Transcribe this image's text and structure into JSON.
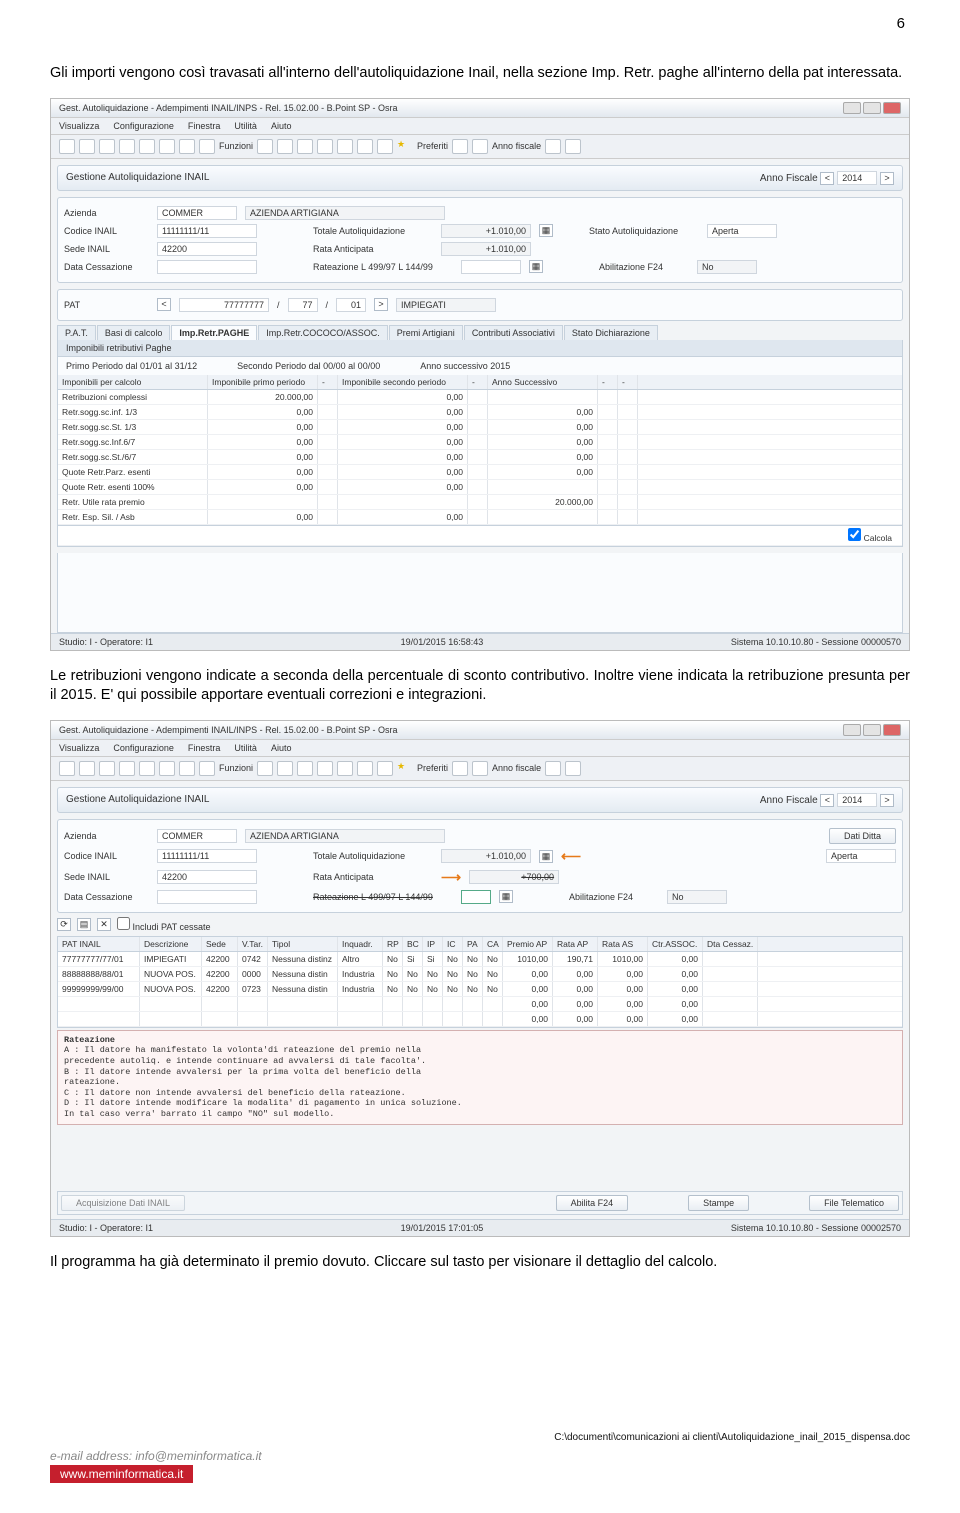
{
  "page_number": "6",
  "para1": "Gli importi vengono così travasati all'interno dell'autoliquidazione Inail, nella sezione Imp. Retr. paghe all'interno della pat interessata.",
  "para2": "Le retribuzioni vengono indicate a seconda della percentuale di sconto contributivo. Inoltre viene indicata la retribuzione presunta per il 2015. E' qui possibile apportare eventuali correzioni e integrazioni.",
  "para3": "Il programma ha già determinato il premio dovuto. Cliccare sul tasto per visionare il dettaglio del calcolo.",
  "footer_path": "C:\\documenti\\comunicazioni ai clienti\\Autoliquidazione_inail_2015_dispensa.doc",
  "footer_email": "e-mail address: info@meminformatica.it",
  "footer_url": "www.meminformatica.it",
  "shot1": {
    "title": "Gest. Autoliquidazione - Adempimenti INAIL/INPS - Rel. 15.02.00 - B.Point SP - Osra",
    "menus": [
      "Visualizza",
      "Configurazione",
      "Finestra",
      "Utilità",
      "Aiuto"
    ],
    "funzioni": "Funzioni",
    "preferiti": "Preferiti",
    "anno_fiscale_lbl": "Anno fiscale",
    "section": "Gestione Autoliquidazione INAIL",
    "anno_fiscale": "2014",
    "anno_lbl": "Anno Fiscale",
    "azienda_lbl": "Azienda",
    "azienda_code": "COMMER",
    "azienda_name": "AZIENDA ARTIGIANA",
    "codice_lbl": "Codice INAIL",
    "codice_val": "11111111/11",
    "totale_lbl": "Totale Autoliquidazione",
    "totale_val": "+1.010,00",
    "stato_lbl": "Stato Autoliquidazione",
    "stato_val": "Aperta",
    "sede_lbl": "Sede INAIL",
    "sede_val": "42200",
    "rata_lbl": "Rata Anticipata",
    "rata_val": "+1.010,00",
    "cess_lbl": "Data Cessazione",
    "rateaz_lbl": "Rateazione L 499/97 L 144/99",
    "abil_lbl": "Abilitazione F24",
    "abil_val": "No",
    "pat_lbl": "PAT",
    "pat_code": "77777777",
    "pat_p1": "77",
    "pat_p2": "01",
    "pat_desc": "IMPIEGATI",
    "tabs": [
      "P.A.T.",
      "Basi di calcolo",
      "Imp.Retr.PAGHE",
      "Imp.Retr.COCOCO/ASSOC.",
      "Premi Artigiani",
      "Contributi Associativi",
      "Stato Dichiarazione"
    ],
    "subheader": "Imponibili retributivi Paghe",
    "period1": "Primo Periodo dal 01/01 al 31/12",
    "period2": "Secondo Periodo dal 00/00 al 00/00",
    "period3": "Anno successivo 2015",
    "grid_headers": [
      "Imponibili per calcolo",
      "Imponibile primo periodo",
      "-",
      "Imponibile secondo periodo",
      "-",
      "Anno Successivo",
      "-",
      "-"
    ],
    "grid_rows": [
      [
        "Retribuzioni complessi",
        "20.000,00",
        "",
        "0,00",
        "",
        "",
        "",
        ""
      ],
      [
        "Retr.sogg.sc.inf. 1/3",
        "0,00",
        "",
        "0,00",
        "",
        "0,00",
        "",
        ""
      ],
      [
        "Retr.sogg.sc.St. 1/3",
        "0,00",
        "",
        "0,00",
        "",
        "0,00",
        "",
        ""
      ],
      [
        "Retr.sogg.sc.Inf.6/7",
        "0,00",
        "",
        "0,00",
        "",
        "0,00",
        "",
        ""
      ],
      [
        "Retr.sogg.sc.St./6/7",
        "0,00",
        "",
        "0,00",
        "",
        "0,00",
        "",
        ""
      ],
      [
        "Quote Retr.Parz. esenti",
        "0,00",
        "",
        "0,00",
        "",
        "0,00",
        "",
        ""
      ],
      [
        "Quote Retr. esenti 100%",
        "0,00",
        "",
        "0,00",
        "",
        "",
        "",
        ""
      ],
      [
        "Retr. Utile rata premio",
        "",
        "",
        "",
        "",
        "20.000,00",
        "",
        ""
      ],
      [
        "Retr. Esp. Sil. / Asb",
        "0,00",
        "",
        "0,00",
        "",
        "",
        "",
        ""
      ]
    ],
    "calcola": "Calcola",
    "status_left": "Studio: I - Operatore: I1",
    "status_date": "19/01/2015  16:58:43",
    "status_right": "Sistema 10.10.10.80 - Sessione 00000570"
  },
  "shot2": {
    "title": "Gest. Autoliquidazione - Adempimenti INAIL/INPS - Rel. 15.02.00 - B.Point SP - Osra",
    "menus": [
      "Visualizza",
      "Configurazione",
      "Finestra",
      "Utilità",
      "Aiuto"
    ],
    "funzioni": "Funzioni",
    "preferiti": "Preferiti",
    "anno_fiscale_lbl": "Anno fiscale",
    "section": "Gestione Autoliquidazione INAIL",
    "anno_fiscale": "2014",
    "anno_lbl": "Anno Fiscale",
    "azienda_lbl": "Azienda",
    "azienda_code": "COMMER",
    "azienda_name": "AZIENDA ARTIGIANA",
    "dati_ditta": "Dati Ditta",
    "codice_lbl": "Codice INAIL",
    "codice_val": "11111111/11",
    "totale_lbl": "Totale Autoliquidazione",
    "totale_val": "+1.010,00",
    "stato_val": "Aperta",
    "sede_lbl": "Sede INAIL",
    "sede_val": "42200",
    "rata_lbl": "Rata Anticipata",
    "rata_val": "+700,00",
    "cess_lbl": "Data Cessazione",
    "rateaz_lbl": "Rateazione L 499/97 L 144/99",
    "abil_lbl": "Abilitazione F24",
    "abil_val": "No",
    "includi": "Includi PAT cessate",
    "grid_headers": [
      "PAT INAIL",
      "Descrizione",
      "Sede",
      "V.Tar.",
      "Tipol",
      "Inquadr.",
      "RP",
      "BC",
      "IP",
      "IC",
      "PA",
      "CA",
      "Premio AP",
      "Rata AP",
      "Rata AS",
      "Ctr.ASSOC.",
      "Dta Cessaz."
    ],
    "grid_rows": [
      [
        "77777777/77/01",
        "IMPIEGATI",
        "42200",
        "0742",
        "Nessuna distinz",
        "Altro",
        "No",
        "Si",
        "Si",
        "No",
        "No",
        "No",
        "1010,00",
        "190,71",
        "1010,00",
        "0,00",
        ""
      ],
      [
        "88888888/88/01",
        "NUOVA POS.",
        "42200",
        "0000",
        "Nessuna distin",
        "Industria",
        "No",
        "No",
        "No",
        "No",
        "No",
        "No",
        "0,00",
        "0,00",
        "0,00",
        "0,00",
        ""
      ],
      [
        "99999999/99/00",
        "NUOVA POS.",
        "42200",
        "0723",
        "Nessuna distin",
        "Industria",
        "No",
        "No",
        "No",
        "No",
        "No",
        "No",
        "0,00",
        "0,00",
        "0,00",
        "0,00",
        ""
      ],
      [
        "",
        "",
        "",
        "",
        "",
        "",
        "",
        "",
        "",
        "",
        "",
        "",
        "0,00",
        "0,00",
        "0,00",
        "0,00",
        ""
      ],
      [
        "",
        "",
        "",
        "",
        "",
        "",
        "",
        "",
        "",
        "",
        "",
        "",
        "0,00",
        "0,00",
        "0,00",
        "0,00",
        ""
      ]
    ],
    "note_title": "Rateazione",
    "note_body": "A : Il datore ha manifestato la volonta'di rateazione del premio nella\n    precedente autoliq. e intende continuare ad avvalersi di tale facolta'.\nB : Il datore intende avvalersi per la prima volta del beneficio della\n    rateazione.\nC : Il datore non intende avvalersi del beneficio della rateazione.\nD : Il datore intende modificare la modalita' di pagamento in unica soluzione.\n    In tal caso verra' barrato il campo \"NO\" sul modello.",
    "btn1": "Acquisizione Dati INAIL",
    "btn2": "Abilita F24",
    "btn3": "Stampe",
    "btn4": "File Telematico",
    "status_left": "Studio: I - Operatore: I1",
    "status_date": "19/01/2015  17:01:05",
    "status_right": "Sistema 10.10.10.80 - Sessione 00002570"
  }
}
